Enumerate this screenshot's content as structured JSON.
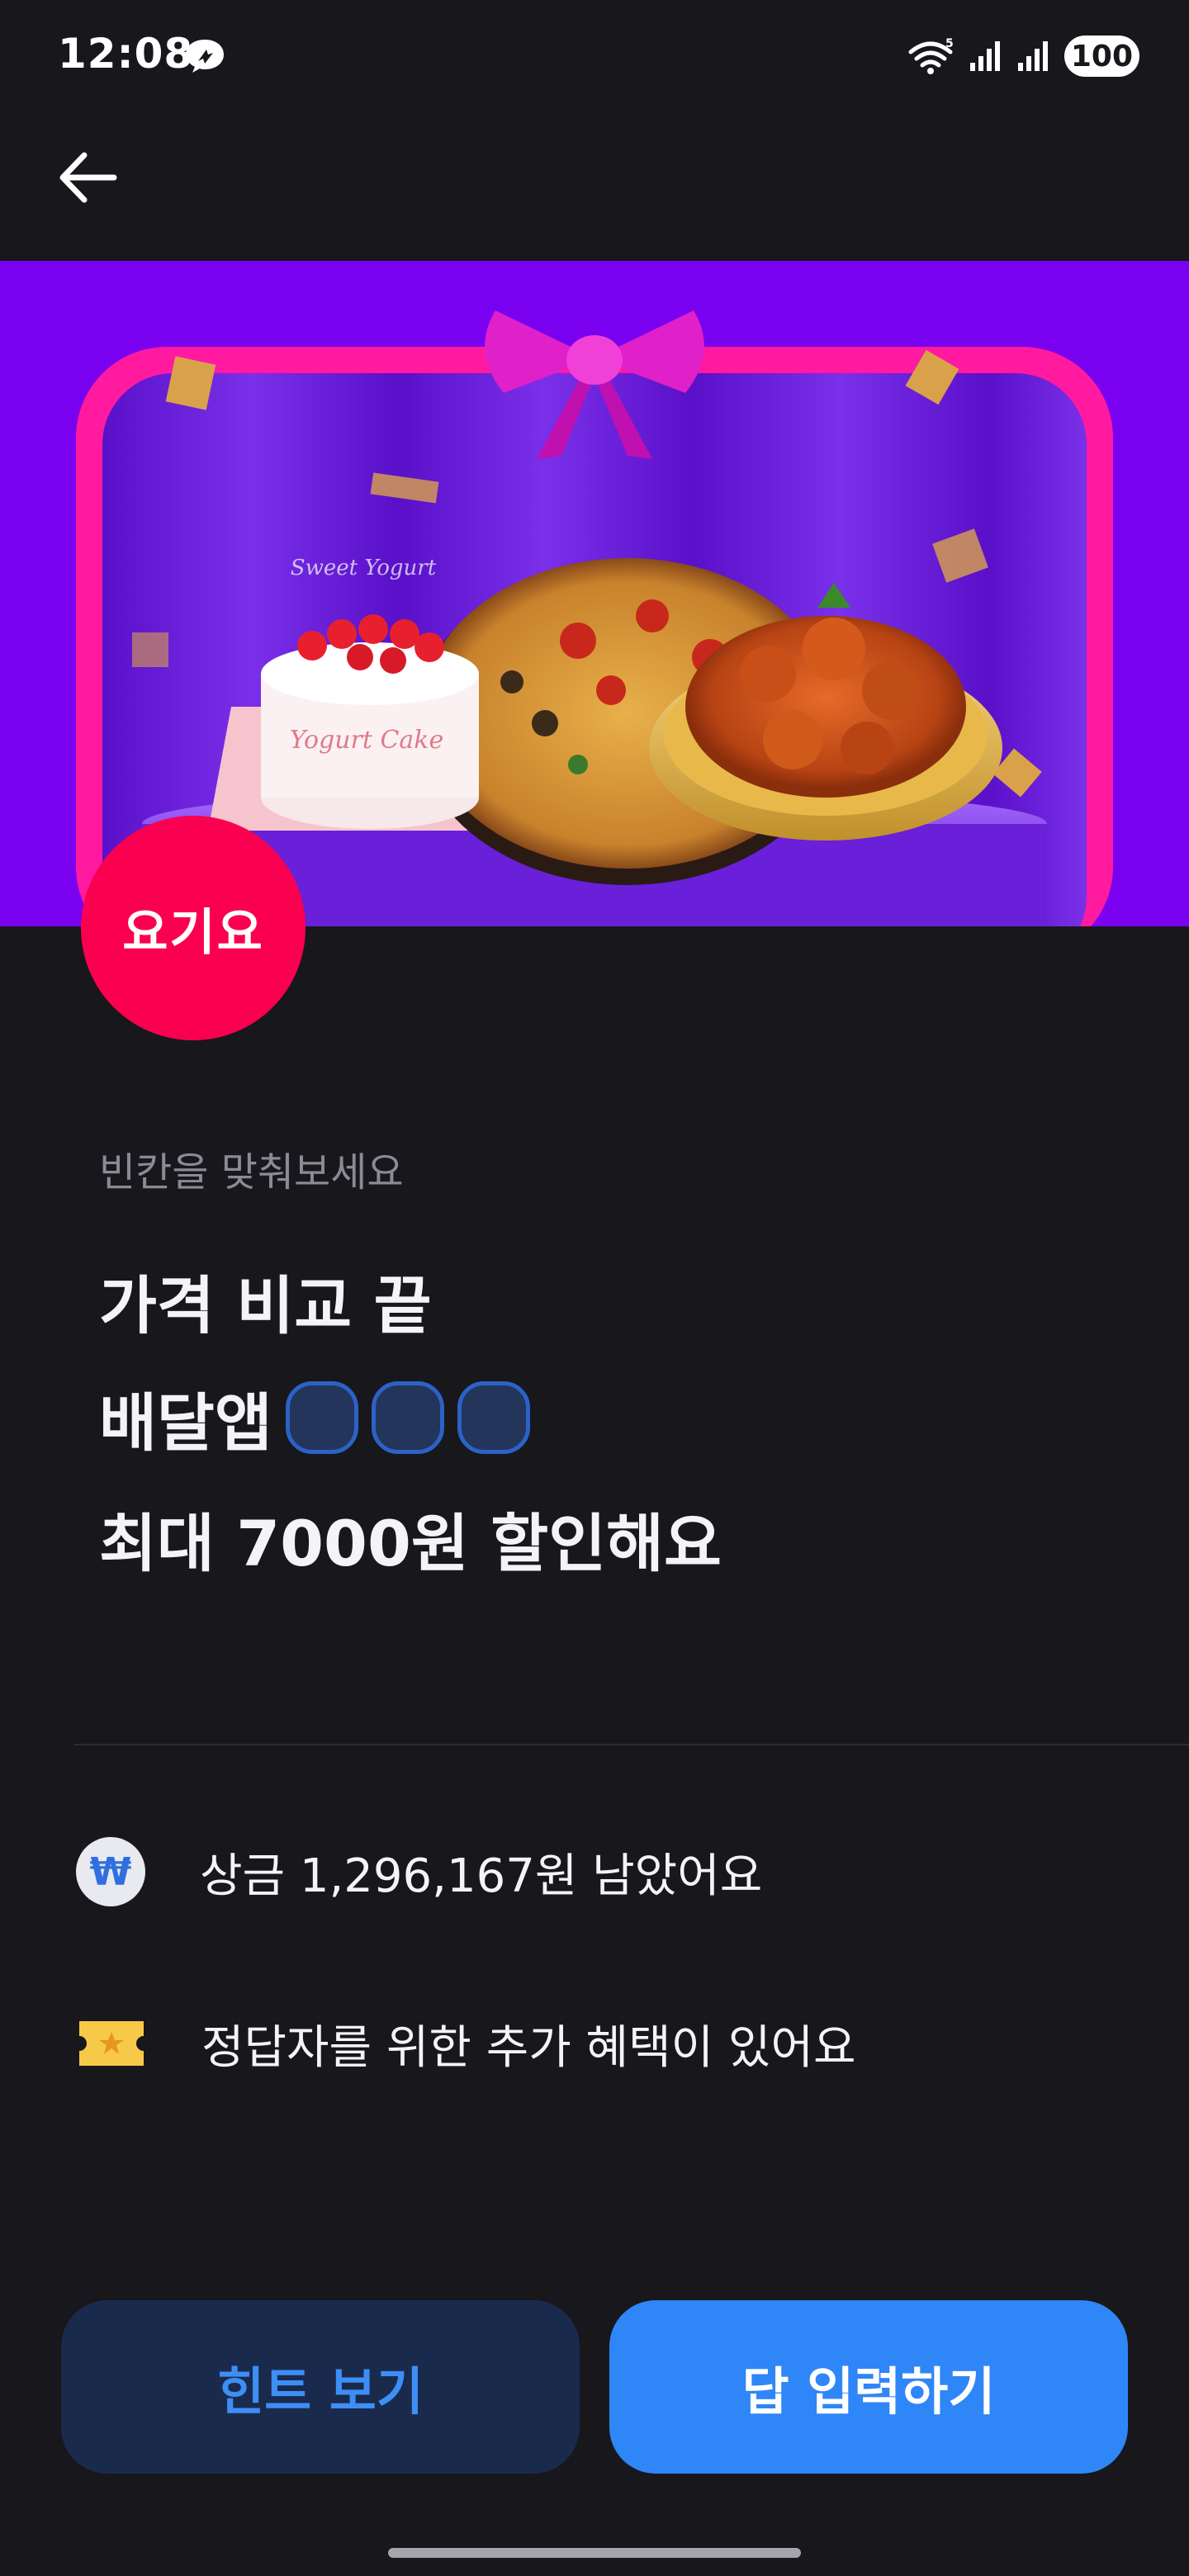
{
  "status_bar": {
    "time": "12:08",
    "battery": "100",
    "network_badge": "5"
  },
  "header": {
    "back_icon": "arrow-left-icon"
  },
  "banner": {
    "brand_logo_text": "요기요",
    "cake_text_1": "Yogurt Cake",
    "cake_text_2": "Sweet Yogurt",
    "colors": {
      "background": "#7a00f0",
      "frame": "#ff1aa0",
      "brand": "#fa0050"
    }
  },
  "quiz": {
    "label": "빈칸을 맞춰보세요",
    "line1": "가격 비교 끝",
    "line2_prefix": "배달앱",
    "blank_count": 3,
    "line3": "최대 7000원 할인해요"
  },
  "info": {
    "prize_icon": "won-coin-icon",
    "prize_icon_glyph": "₩",
    "prize_text": "상금 1,296,167원 남았어요",
    "bonus_icon": "ticket-icon",
    "bonus_text": "정답자를 위한 추가 혜택이 있어요"
  },
  "buttons": {
    "hint": "힌트 보기",
    "answer": "답 입력하기"
  },
  "colors": {
    "background": "#17171c",
    "primary": "#2f86f6",
    "secondary_bg": "#1a2a4d"
  }
}
